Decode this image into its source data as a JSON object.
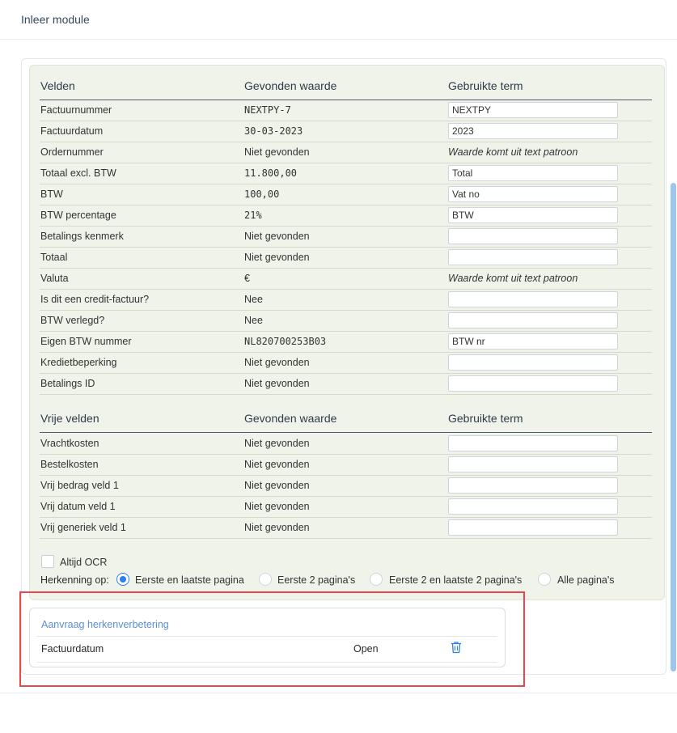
{
  "modal": {
    "title": "Inleer module"
  },
  "fields_section": {
    "headers": {
      "col1": "Velden",
      "col2": "Gevonden waarde",
      "col3": "Gebruikte term"
    },
    "rows": [
      {
        "label": "Factuurnummer",
        "value": "NEXTPY-7",
        "term": "NEXTPY",
        "term_type": "input",
        "mono": true
      },
      {
        "label": "Factuurdatum",
        "value": "30-03-2023",
        "term": "2023",
        "term_type": "input",
        "mono": true
      },
      {
        "label": "Ordernummer",
        "value": "Niet gevonden",
        "term": "Waarde komt uit text patroon",
        "term_type": "pattern",
        "mono": false
      },
      {
        "label": "Totaal excl. BTW",
        "value": "11.800,00",
        "term": "Total",
        "term_type": "input",
        "mono": true
      },
      {
        "label": "BTW",
        "value": "100,00",
        "term": "Vat no",
        "term_type": "input",
        "mono": true
      },
      {
        "label": "BTW percentage",
        "value": "21%",
        "term": "BTW",
        "term_type": "input",
        "mono": true
      },
      {
        "label": "Betalings kenmerk",
        "value": "Niet gevonden",
        "term": "",
        "term_type": "input",
        "mono": false
      },
      {
        "label": "Totaal",
        "value": "Niet gevonden",
        "term": "",
        "term_type": "input",
        "mono": false
      },
      {
        "label": "Valuta",
        "value": "€",
        "term": "Waarde komt uit text patroon",
        "term_type": "pattern",
        "mono": false
      },
      {
        "label": "Is dit een credit-factuur?",
        "value": "Nee",
        "term": "",
        "term_type": "input",
        "mono": false
      },
      {
        "label": "BTW verlegd?",
        "value": "Nee",
        "term": "",
        "term_type": "input",
        "mono": false
      },
      {
        "label": "Eigen BTW nummer",
        "value": "NL820700253B03",
        "term": "BTW nr",
        "term_type": "input",
        "mono": true
      },
      {
        "label": "Kredietbeperking",
        "value": "Niet gevonden",
        "term": "",
        "term_type": "input",
        "mono": false
      },
      {
        "label": "Betalings ID",
        "value": "Niet gevonden",
        "term": "",
        "term_type": "input",
        "mono": false
      }
    ]
  },
  "free_section": {
    "headers": {
      "col1": "Vrije velden",
      "col2": "Gevonden waarde",
      "col3": "Gebruikte term"
    },
    "rows": [
      {
        "label": "Vrachtkosten",
        "value": "Niet gevonden",
        "term": ""
      },
      {
        "label": "Bestelkosten",
        "value": "Niet gevonden",
        "term": ""
      },
      {
        "label": "Vrij bedrag veld 1",
        "value": "Niet gevonden",
        "term": ""
      },
      {
        "label": "Vrij datum veld 1",
        "value": "Niet gevonden",
        "term": ""
      },
      {
        "label": "Vrij generiek veld 1",
        "value": "Niet gevonden",
        "term": ""
      }
    ]
  },
  "options": {
    "always_ocr_label": "Altijd OCR",
    "always_ocr_checked": false,
    "recognition_label": "Herkenning op:",
    "radios": [
      {
        "label": "Eerste en laatste pagina",
        "checked": true
      },
      {
        "label": "Eerste 2 pagina's",
        "checked": false
      },
      {
        "label": "Eerste 2 en laatste 2 pagina's",
        "checked": false
      },
      {
        "label": "Alle pagina's",
        "checked": false
      }
    ]
  },
  "request": {
    "title": "Aanvraag herkenverbetering",
    "item": {
      "field": "Factuurdatum",
      "status": "Open",
      "icon": "trash-icon"
    }
  },
  "colors": {
    "accent": "#2f80ed",
    "panel": "#eff3ea",
    "highlight": "#e5484d",
    "link": "#5b8fd6"
  }
}
